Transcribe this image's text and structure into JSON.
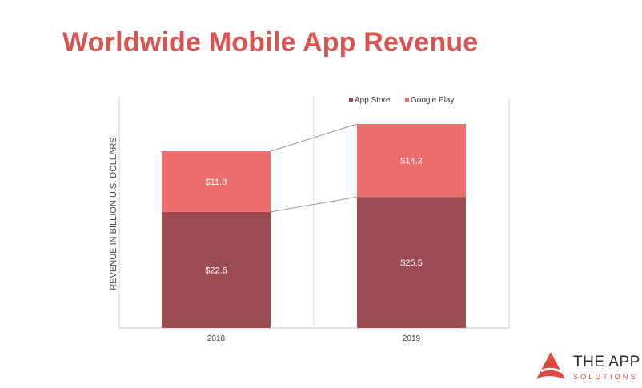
{
  "header": {
    "title": "Worldwide Mobile App Revenue"
  },
  "chart_data": {
    "type": "bar",
    "stacked": true,
    "categories": [
      "2018",
      "2019"
    ],
    "series": [
      {
        "name": "App Store",
        "values": [
          22.6,
          25.5
        ],
        "color": "#9c4b53",
        "labels": [
          "$22.6",
          "$25.5"
        ]
      },
      {
        "name": "Google Play",
        "values": [
          11.8,
          14.2
        ],
        "color": "#ef6e6c",
        "labels": [
          "$11.8",
          "$14.2"
        ]
      }
    ],
    "ylabel": "REVENUE IN BILLION U.S. DOLLARS",
    "xlabel": "",
    "ylim": [
      0,
      45
    ],
    "grid": false,
    "legend": "top-right",
    "series_connectors": true
  },
  "brand": {
    "name": "THE APP",
    "tagline": "SOLUTIONS",
    "accent": "#e0473f",
    "title_color": "#d9534f"
  }
}
